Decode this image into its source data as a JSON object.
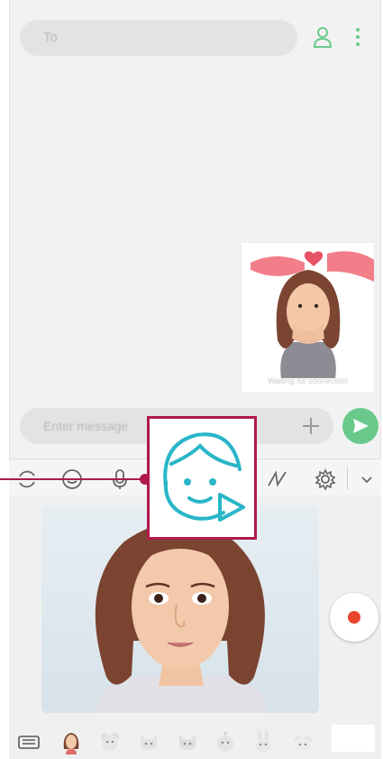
{
  "header": {
    "to_placeholder": "To",
    "contact_icon": "contact-icon",
    "more_icon": "more-options-icon"
  },
  "message": {
    "sticker_caption": "Waiting for connection"
  },
  "compose": {
    "placeholder": "Enter message",
    "plus_icon": "plus-icon",
    "send_icon": "send-icon"
  },
  "tools": [
    "rotate-camera-icon",
    "smiley-icon",
    "mic-icon",
    "ar-emoji-icon",
    "doodle-icon",
    "settings-icon",
    "chevron-down-icon"
  ],
  "tray": [
    "keyboard-icon",
    "avatar-icon",
    "bear-icon",
    "cat-icon",
    "cat-icon",
    "bird-icon",
    "rabbit-icon",
    "sheep-icon"
  ],
  "colors": {
    "accent_green": "#69c98b",
    "callout": "#b0194d",
    "ar_icon": "#29b6c8",
    "record": "#e8452c"
  }
}
